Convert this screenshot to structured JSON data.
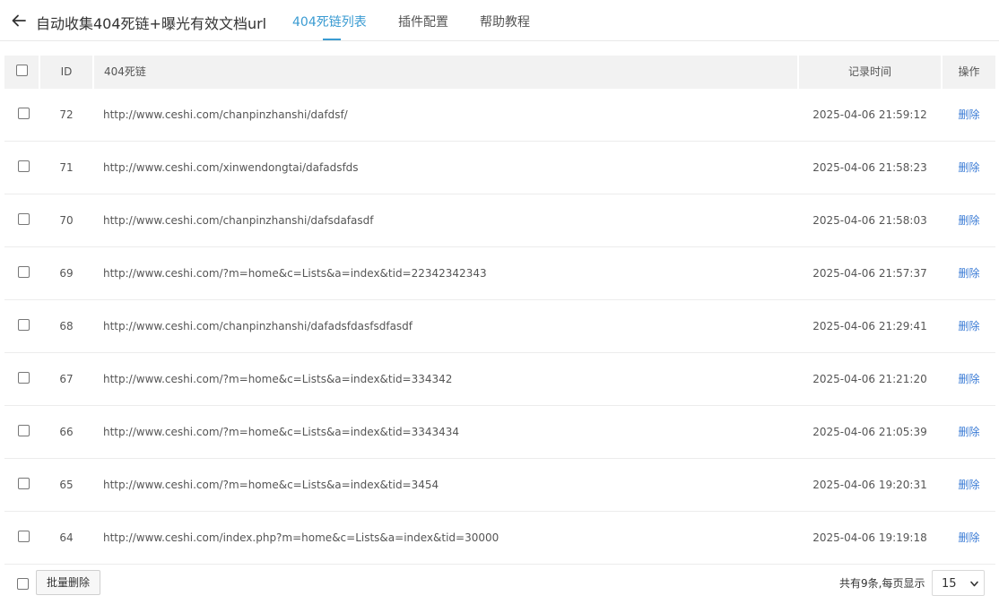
{
  "header": {
    "title": "自动收集404死链+曝光有效文档url",
    "tabs": [
      {
        "label": "404死链列表",
        "active": true
      },
      {
        "label": "插件配置",
        "active": false
      },
      {
        "label": "帮助教程",
        "active": false
      }
    ]
  },
  "table": {
    "columns": {
      "id": "ID",
      "url": "404死链",
      "time": "记录时间",
      "action": "操作"
    },
    "rows": [
      {
        "id": "72",
        "url": "http://www.ceshi.com/chanpinzhanshi/dafdsf/",
        "time": "2025-04-06 21:59:12",
        "action": "删除"
      },
      {
        "id": "71",
        "url": "http://www.ceshi.com/xinwendongtai/dafadsfds",
        "time": "2025-04-06 21:58:23",
        "action": "删除"
      },
      {
        "id": "70",
        "url": "http://www.ceshi.com/chanpinzhanshi/dafsdafasdf",
        "time": "2025-04-06 21:58:03",
        "action": "删除"
      },
      {
        "id": "69",
        "url": "http://www.ceshi.com/?m=home&c=Lists&a=index&tid=22342342343",
        "time": "2025-04-06 21:57:37",
        "action": "删除"
      },
      {
        "id": "68",
        "url": "http://www.ceshi.com/chanpinzhanshi/dafadsfdasfsdfasdf",
        "time": "2025-04-06 21:29:41",
        "action": "删除"
      },
      {
        "id": "67",
        "url": "http://www.ceshi.com/?m=home&c=Lists&a=index&tid=334342",
        "time": "2025-04-06 21:21:20",
        "action": "删除"
      },
      {
        "id": "66",
        "url": "http://www.ceshi.com/?m=home&c=Lists&a=index&tid=3343434",
        "time": "2025-04-06 21:05:39",
        "action": "删除"
      },
      {
        "id": "65",
        "url": "http://www.ceshi.com/?m=home&c=Lists&a=index&tid=3454",
        "time": "2025-04-06 19:20:31",
        "action": "删除"
      },
      {
        "id": "64",
        "url": "http://www.ceshi.com/index.php?m=home&c=Lists&a=index&tid=30000",
        "time": "2025-04-06 19:19:18",
        "action": "删除"
      }
    ]
  },
  "footer": {
    "batch_delete_label": "批量删除",
    "pager_text": "共有9条,每页显示",
    "per_page_value": "15"
  },
  "colors": {
    "accent": "#3a9bd2",
    "link": "#3a7bd5",
    "header_bg": "#f2f2f2"
  },
  "icons": {
    "back": "arrow-left-icon",
    "select": "chevron-down-icon"
  }
}
